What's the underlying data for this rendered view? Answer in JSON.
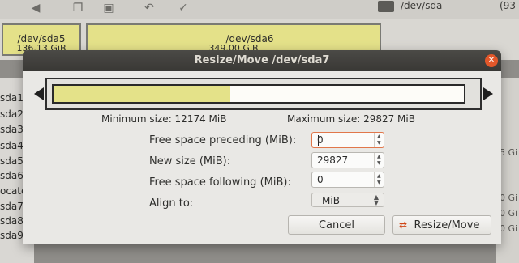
{
  "background": {
    "toolbar": {
      "device_label": "/dev/sda",
      "device_size": "(93"
    },
    "partitions": [
      {
        "name": "/dev/sda5",
        "size": "136.13 GiB"
      },
      {
        "name": "/dev/sda6",
        "size": "349.00 GiB"
      }
    ],
    "list_rows": [
      "sda1",
      "sda2",
      "sda3",
      "sda4",
      "sda5",
      "sda6",
      "ocated",
      "sda7",
      "sda8",
      "sda9"
    ],
    "right_rows": [
      "5 Gi",
      "0 Gi",
      "0 Gi",
      "0 Gi"
    ]
  },
  "dialog": {
    "title": "Resize/Move /dev/sda7",
    "min_size": "Minimum size: 12174 MiB",
    "max_size": "Maximum size: 29827 MiB",
    "fields": {
      "preceding_label": "Free space preceding (MiB):",
      "preceding_value": "0",
      "new_size_label": "New size (MiB):",
      "new_size_value": "29827",
      "following_label": "Free space following (MiB):",
      "following_value": "0",
      "align_label": "Align to:",
      "align_value": "MiB"
    },
    "buttons": {
      "cancel": "Cancel",
      "resize": "Resize/Move"
    },
    "used_fraction": 0.43
  },
  "colors": {
    "partition_fill": "#e4e289",
    "titlebar": "#3e3d39",
    "close": "#e2572a",
    "accent": "#d04616"
  }
}
